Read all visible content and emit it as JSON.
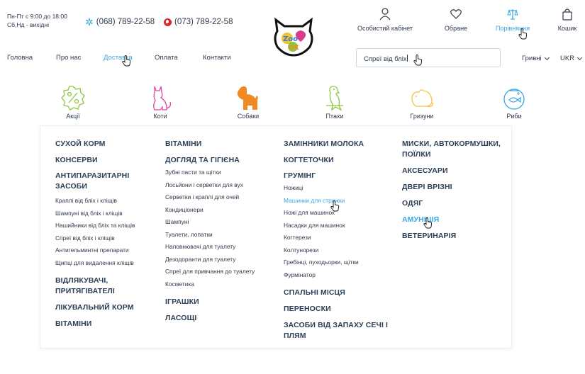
{
  "header": {
    "hours_line1": "Пн-Пт с 9:00 до 18:00",
    "hours_line2": "Сб,Нд - вихідні",
    "phone1": "(068) 789-22-58",
    "phone2": "(073) 789-22-58",
    "actions": {
      "account": "Особистий кабінет",
      "favorites": "Обране",
      "compare": "Порівняння",
      "cart": "Кошик"
    }
  },
  "nav": {
    "home": "Головна",
    "about": "Про нас",
    "delivery": "Доставка",
    "payment": "Оплата",
    "contacts": "Контакти"
  },
  "search": {
    "value": "Спреї від бліх"
  },
  "currency": "Гривні",
  "language": "UKR",
  "categories": [
    "Акції",
    "Коти",
    "Собаки",
    "Птахи",
    "Гризуни",
    "Риби"
  ],
  "colors": {
    "accent": "#36a6e0",
    "dog_icon": "#f08a24",
    "bird_icon": "#8dc63f",
    "rodent_icon": "#f6c344",
    "cat_icon": "#e0479e"
  },
  "menu": {
    "col1": {
      "dry_food": "СУХОЙ КОРМ",
      "canned": "КОНСЕРВИ",
      "antiparasitic": "АНТИПАРАЗИТАРНІ ЗАСОБИ",
      "antiparasitic_items": [
        "Краплі від бліх і кліщів",
        "Шампуні від бліх і кліщів",
        "Нашийники від бліх та кліщів",
        "Спреї від бліх і кліщів",
        "Антигельминтні препарати",
        "Щипці для видалення кліщів"
      ],
      "repellents": "ВІДЛЯКУВАЧІ, ПРИТЯГІВАТЕЛІ",
      "medical_food": "ЛІКУВАЛЬНИЙ КОРМ",
      "vitamins": "ВІТАМІНИ"
    },
    "col2": {
      "vitamins": "ВІТАМІНИ",
      "care": "ДОГЛЯД ТА ГІГІЄНА",
      "care_items": [
        "Зубні пасти та щітки",
        "Лосьйони і серветки для вух",
        "Серветки і краплі для очей",
        "Кондиціонери",
        "Шампуні",
        "Туалети, лопатки",
        "Наповнювачі для туалету",
        "Дезодоранти для туалету",
        "Спреї для привчання до туалету",
        "Косметика"
      ],
      "toys": "ІГРАШКИ",
      "treats": "ЛАСОЩІ"
    },
    "col3": {
      "milk": "ЗАМІННИКИ МОЛОКА",
      "scratchers": "КОГТЕТОЧКИ",
      "grooming": "ГРУМІНГ",
      "grooming_items": [
        "Ножиці",
        "Машинки для стрижки",
        "Ножі для машинок",
        "Насадки для машинок",
        "Когтерези",
        "Колтунорези",
        "Гребінці, пуходьорки, щітки",
        "Фурмінатор"
      ],
      "beds": "СПАЛЬНІ МІСЦЯ",
      "carriers": "ПЕРЕНОСКИ",
      "odor": "ЗАСОБИ ВІД ЗАПАХУ СЕЧІ І ПЛЯМ"
    },
    "col4": {
      "bowls": "МИСКИ, АВТОКОРМУШКИ, ПОЇЛКИ",
      "accessories": "АКСЕСУАРИ",
      "doors": "ДВЕРІ ВРІЗНІ",
      "clothes": "ОДЯГ",
      "ammo": "АМУНІЦІЯ",
      "vet": "ВЕТЕРИНАРІЯ"
    }
  }
}
